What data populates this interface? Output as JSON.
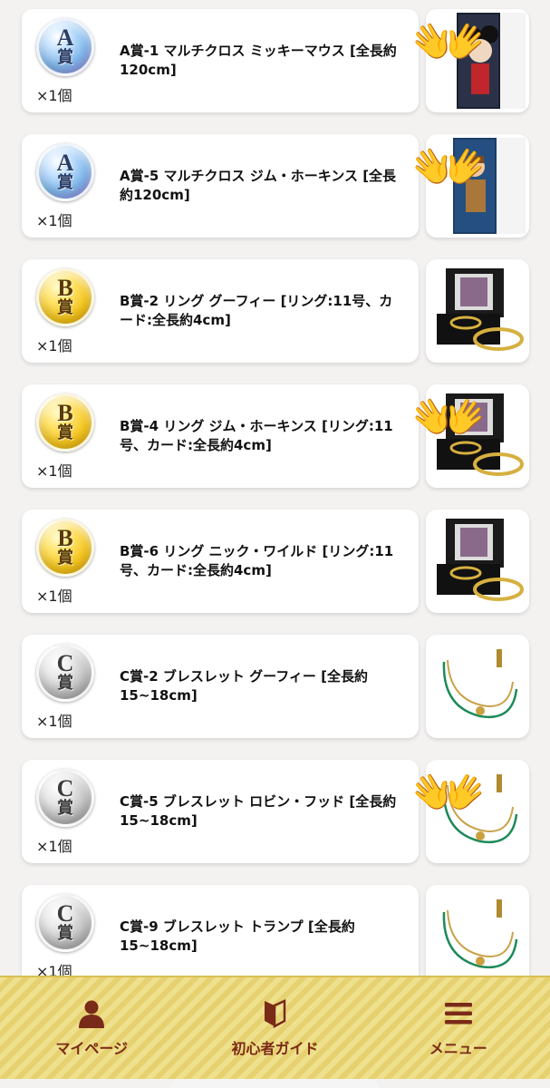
{
  "prizes": [
    {
      "letter": "A",
      "kanji": "賞",
      "tier": "blue",
      "title": "A賞-1 マルチクロス ミッキーマウス [全長約120cm]",
      "qty": "×1個",
      "thumb_icon": "mickey-cloth-thumbnail",
      "hands": true
    },
    {
      "letter": "A",
      "kanji": "賞",
      "tier": "blue",
      "title": "A賞-5 マルチクロス ジム・ホーキンス [全長約120cm]",
      "qty": "×1個",
      "thumb_icon": "jim-cloth-thumbnail",
      "hands": true
    },
    {
      "letter": "B",
      "kanji": "賞",
      "tier": "gold",
      "title": "B賞-2 リング グーフィー [リング:11号、カード:全長約4cm]",
      "qty": "×1個",
      "thumb_icon": "ring-box-thumbnail",
      "hands": false
    },
    {
      "letter": "B",
      "kanji": "賞",
      "tier": "gold",
      "title": "B賞-4 リング ジム・ホーキンス [リング:11号、カード:全長約4cm]",
      "qty": "×1個",
      "thumb_icon": "ring-box-thumbnail",
      "hands": true
    },
    {
      "letter": "B",
      "kanji": "賞",
      "tier": "gold",
      "title": "B賞-6 リング ニック・ワイルド [リング:11号、カード:全長約4cm]",
      "qty": "×1個",
      "thumb_icon": "ring-box-thumbnail",
      "hands": false
    },
    {
      "letter": "C",
      "kanji": "賞",
      "tier": "silver",
      "title": "C賞-2 ブレスレット グーフィー [全長約15~18cm]",
      "qty": "×1個",
      "thumb_icon": "bracelet-thumbnail",
      "hands": false
    },
    {
      "letter": "C",
      "kanji": "賞",
      "tier": "silver",
      "title": "C賞-5 ブレスレット ロビン・フッド [全長約15~18cm]",
      "qty": "×1個",
      "thumb_icon": "bracelet-thumbnail",
      "hands": true
    },
    {
      "letter": "C",
      "kanji": "賞",
      "tier": "silver",
      "title": "C賞-9 ブレスレット トランプ [全長約15~18cm]",
      "qty": "×1個",
      "thumb_icon": "bracelet-thumbnail",
      "hands": false
    }
  ],
  "overlay_emoji": "👐",
  "bottom_nav": {
    "items": [
      {
        "label": "マイページ",
        "icon": "person-icon"
      },
      {
        "label": "初心者ガイド",
        "icon": "beginner-mark-icon"
      },
      {
        "label": "メニュー",
        "icon": "hamburger-menu-icon"
      }
    ]
  },
  "colors": {
    "nav_label": "#7a2a18",
    "nav_bg": "#efe08e",
    "badge_blue": "#7fb6ea",
    "badge_gold": "#f2c21a",
    "badge_silver": "#b9b9b9"
  }
}
